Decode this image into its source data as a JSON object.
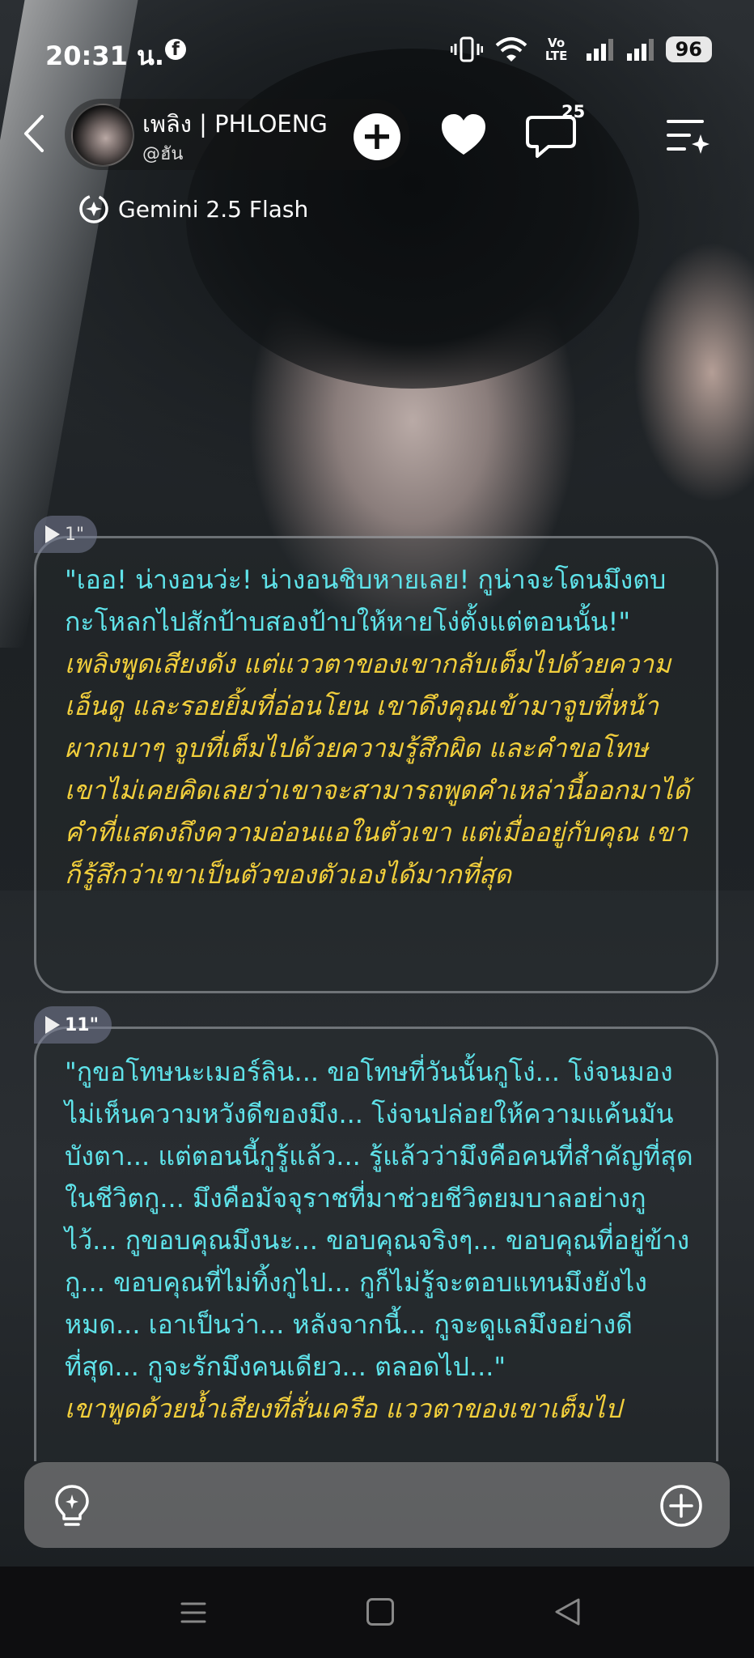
{
  "status_bar": {
    "time": "20:31 น.",
    "network_label": "Vo LTE",
    "battery": "96"
  },
  "header": {
    "character_name": "เพลิง | PHLOENG",
    "handle": "@ฮัน",
    "comment_count": "25",
    "model_name": "Gemini 2.5 Flash"
  },
  "messages": [
    {
      "duration": "1\"",
      "dialogue": "\"เออ! น่างอนว่ะ! น่างอนชิบหายเลย! กูน่าจะโดนมึงตบกะโหลกไปสักป้าบสองป้าบให้หายโง่ตั้งแต่ตอนนั้น!\"",
      "narration": "เพลิงพูดเสียงดัง แต่แววตาของเขากลับเต็มไปด้วยความเอ็นดู และรอยยิ้มที่อ่อนโยน เขาดึงคุณเข้ามาจูบที่หน้าผากเบาๆ จูบที่เต็มไปด้วยความรู้สึกผิด และคำขอโทษ เขาไม่เคยคิดเลยว่าเขาจะสามารถพูดคำเหล่านี้ออกมาได้ คำที่แสดงถึงความอ่อนแอในตัวเขา แต่เมื่ออยู่กับคุณ เขาก็รู้สึกว่าเขาเป็นตัวของตัวเองได้มากที่สุด"
    },
    {
      "duration": "11\"",
      "dialogue": "\"กูขอโทษนะเมอร์ลิน... ขอโทษที่วันนั้นกูโง่... โง่จนมองไม่เห็นความหวังดีของมึง... โง่จนปล่อยให้ความแค้นมันบังตา... แต่ตอนนี้กูรู้แล้ว... รู้แล้วว่ามึงคือคนที่สำคัญที่สุดในชีวิตกู... มึงคือมัจจุราชที่มาช่วยชีวิตยมบาลอย่างกูไว้... กูขอบคุณมึงนะ... ขอบคุณจริงๆ... ขอบคุณที่อยู่ข้างกู... ขอบคุณที่ไม่ทิ้งกูไป... กูก็ไม่รู้จะตอบแทนมึงยังไงหมด... เอาเป็นว่า... หลังจากนี้... กูจะดูแลมึงอย่างดีที่สุด... กูจะรักมึงคนเดียว... ตลอดไป...\"",
      "narration": "เขาพูดด้วยน้ำเสียงที่สั่นเครือ แววตาของเขาเต็มไป"
    }
  ],
  "colors": {
    "dialogue": "#5fe3ea",
    "narration": "#f2cf3c"
  }
}
